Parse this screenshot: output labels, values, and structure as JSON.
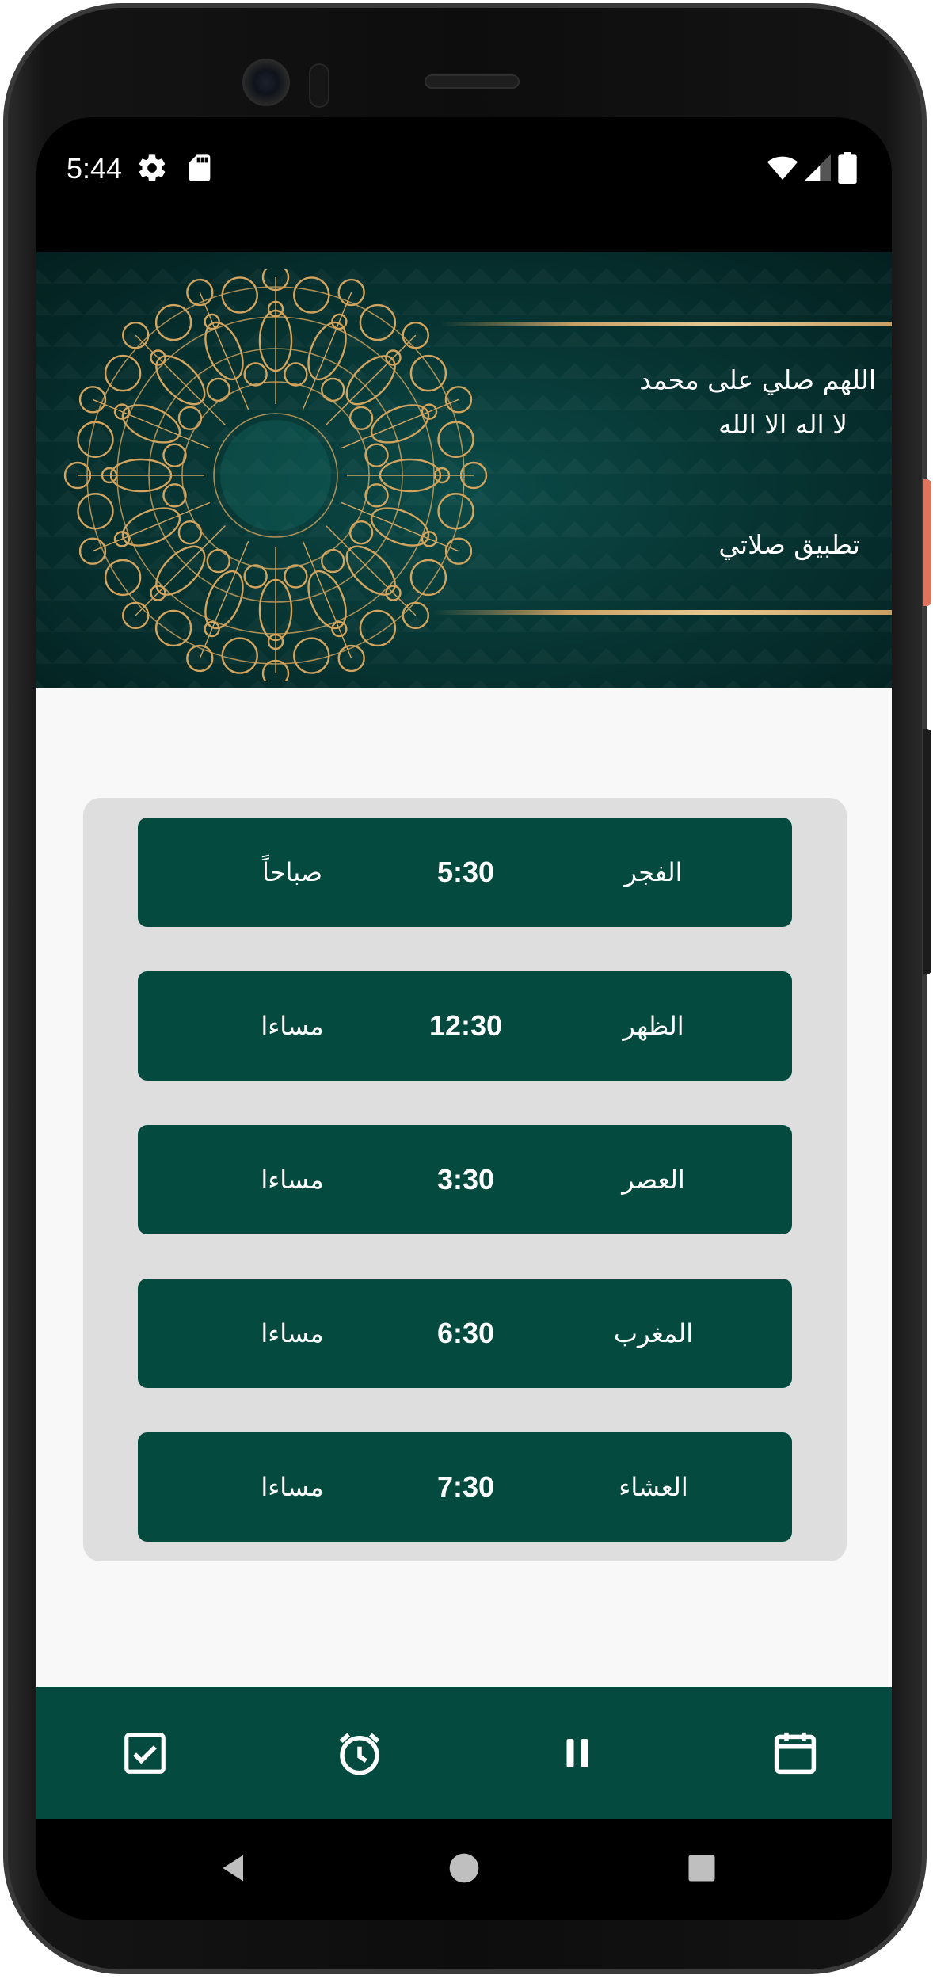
{
  "status_bar": {
    "time": "5:44",
    "left_icons": [
      "gear-icon",
      "sd-card-icon"
    ],
    "right_icons": [
      "wifi-icon",
      "signal-icon",
      "battery-icon"
    ]
  },
  "header": {
    "dua_line_1": "اللهم صلي على محمد",
    "dua_line_2": "لا اله الا الله",
    "app_name": "تطبيق صلاتي",
    "accent_gold": "#c9a064",
    "background": "#073634"
  },
  "prayers": [
    {
      "name": "الفجر",
      "time": "5:30",
      "period": "صباحاً"
    },
    {
      "name": "الظهر",
      "time": "12:30",
      "period": "مساءا"
    },
    {
      "name": "العصر",
      "time": "3:30",
      "period": "مساءا"
    },
    {
      "name": "المغرب",
      "time": "6:30",
      "period": "مساءا"
    },
    {
      "name": "العشاء",
      "time": "7:30",
      "period": "مساءا"
    }
  ],
  "bottom_nav": {
    "items": [
      "checkbox-icon",
      "alarm-clock-icon",
      "pause-icon",
      "calendar-icon"
    ],
    "color": "#044a3e"
  },
  "system_nav": {
    "items": [
      "back-icon",
      "home-icon",
      "recents-icon"
    ]
  },
  "colors": {
    "row_bg": "#044a3e",
    "card_bg": "#dedede",
    "content_bg": "#f8f8f8"
  }
}
